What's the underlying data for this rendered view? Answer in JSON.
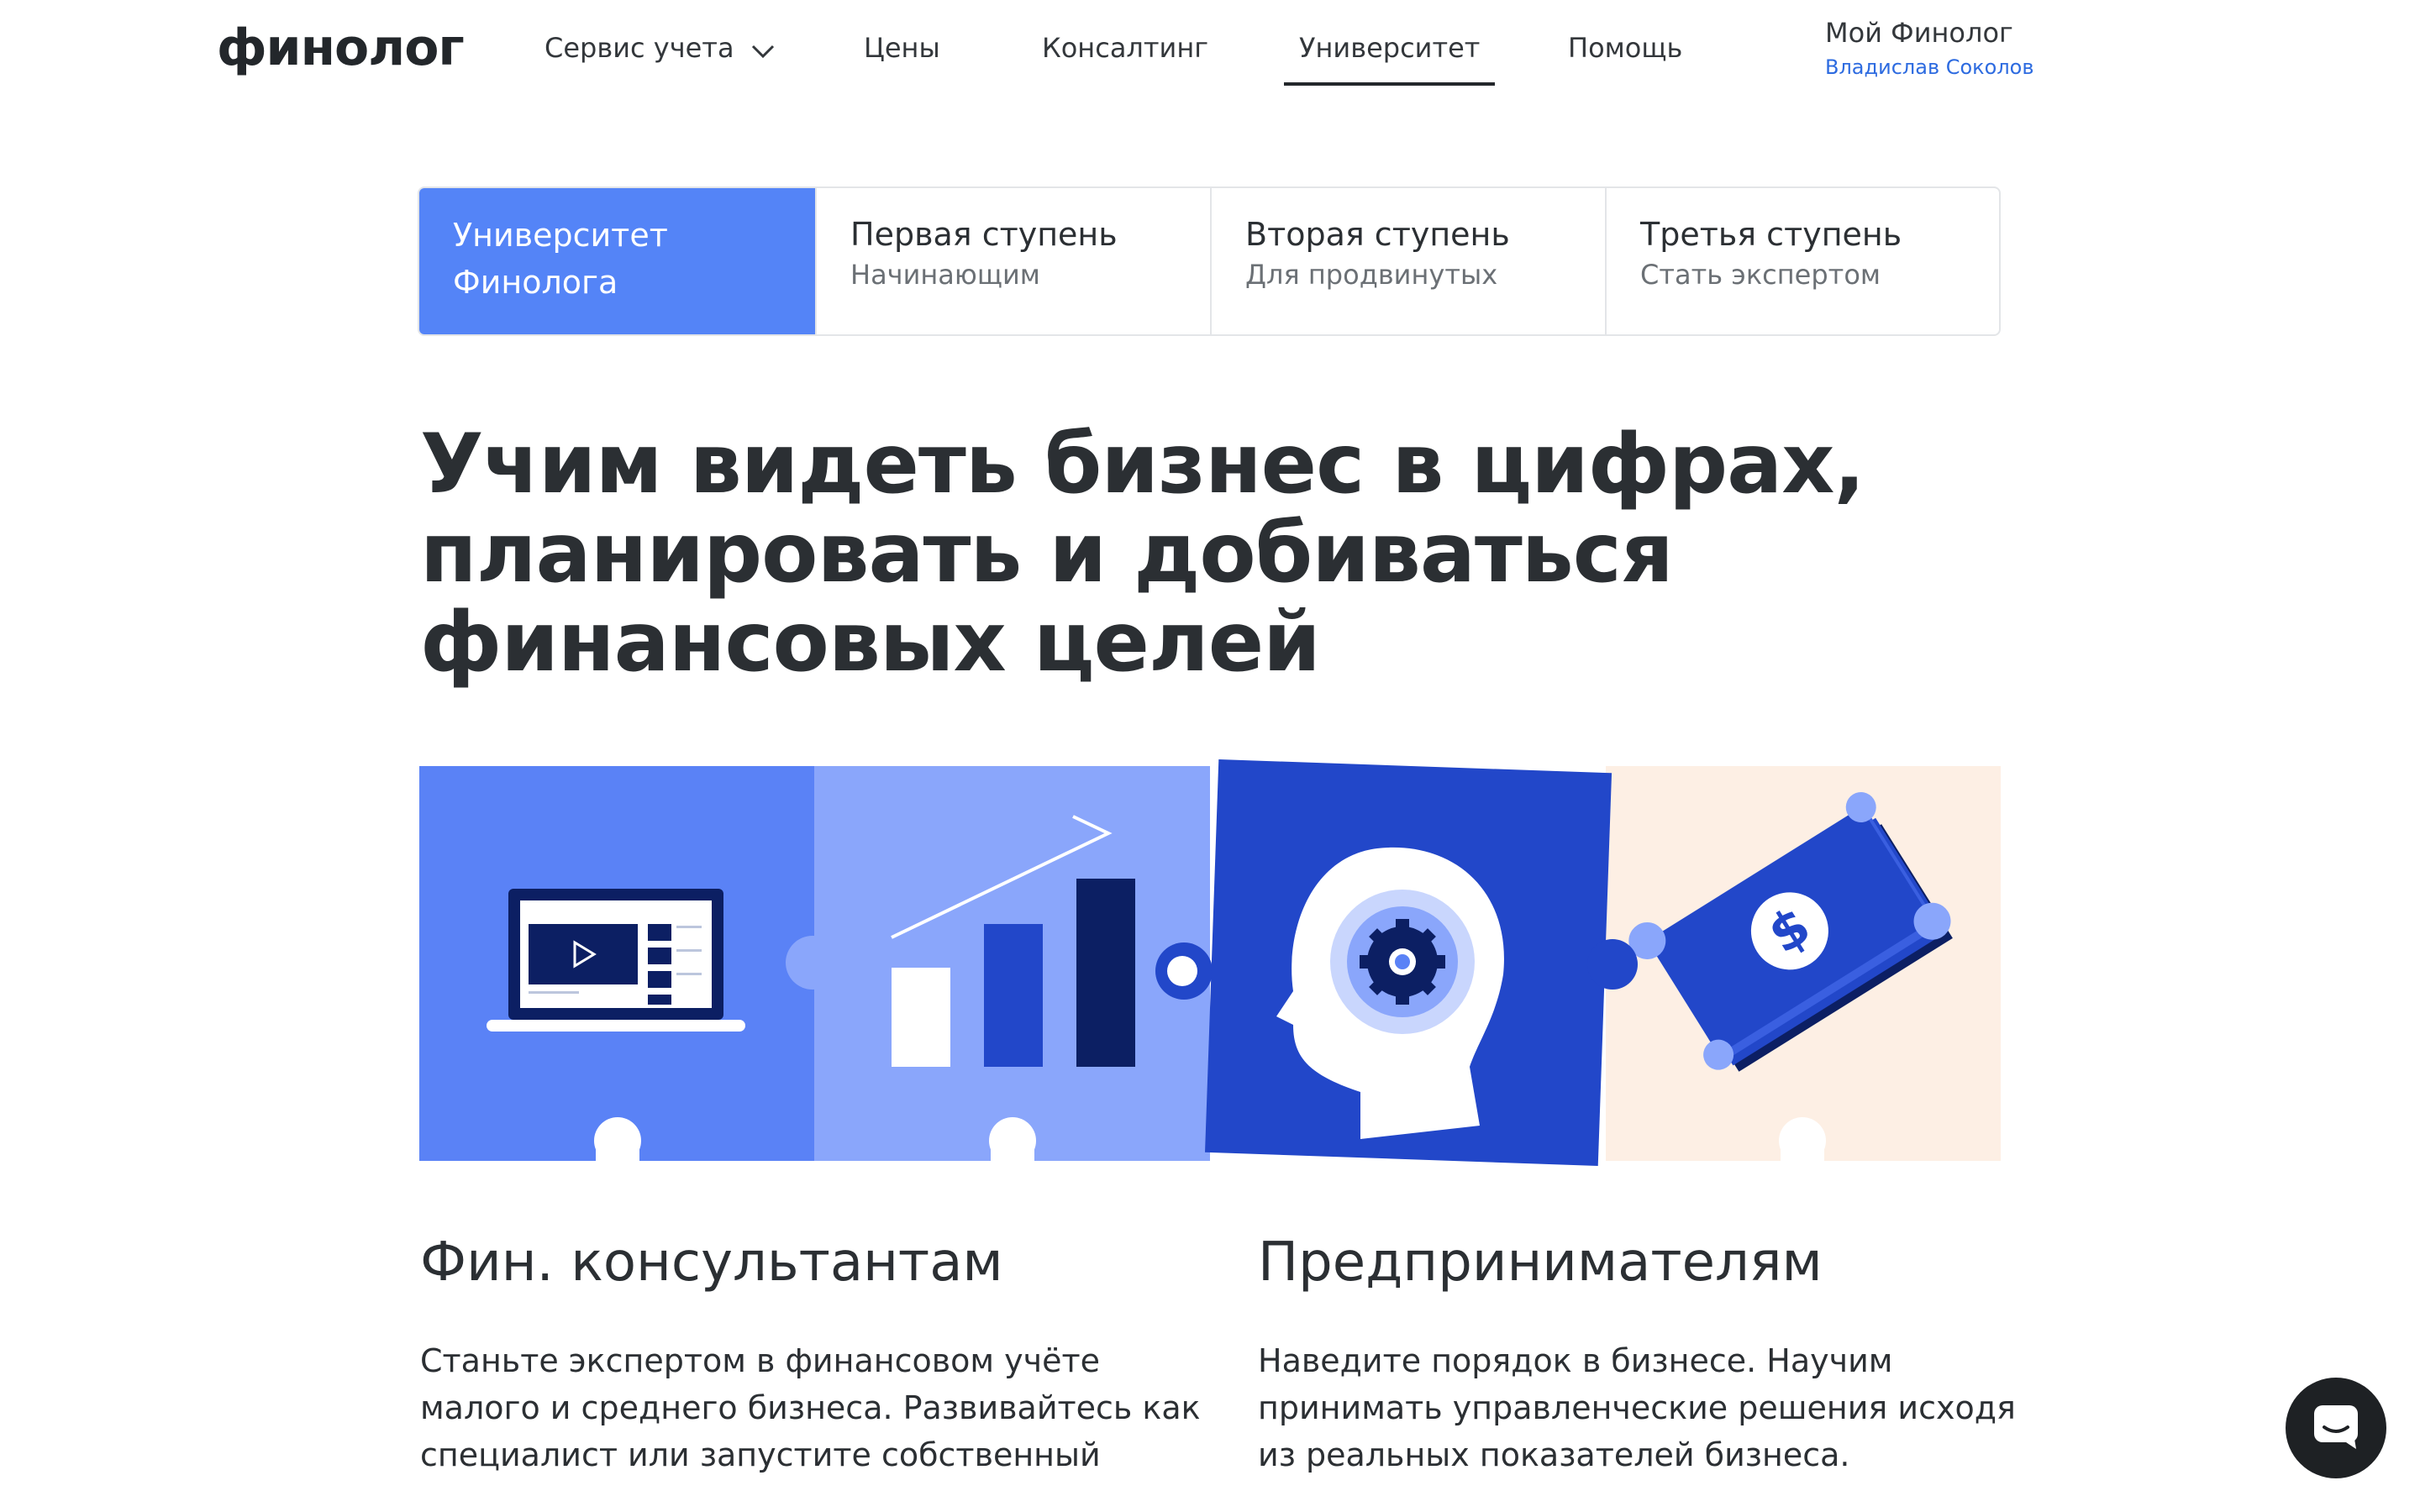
{
  "header": {
    "logo": "финолог",
    "nav": [
      {
        "label": "Сервис учета",
        "has_dropdown": true
      },
      {
        "label": "Цены"
      },
      {
        "label": "Консалтинг"
      },
      {
        "label": "Университет",
        "active": true
      },
      {
        "label": "Помощь"
      }
    ],
    "account": {
      "title": "Мой Финолог",
      "user": "Владислав Соколов"
    }
  },
  "tabs": [
    {
      "title_line1": "Университет",
      "title_line2": "Финолога",
      "active": true
    },
    {
      "title": "Первая ступень",
      "subtitle": "Начинающим"
    },
    {
      "title": "Вторая ступень",
      "subtitle": "Для продвинутых"
    },
    {
      "title": "Третья ступень",
      "subtitle": "Стать экспертом"
    }
  ],
  "headline": {
    "line1": "Учим видеть бизнес в цифрах,",
    "line2": "планировать и добиваться",
    "line3": "финансовых целей"
  },
  "illustration": {
    "icons": [
      "laptop-video-icon",
      "growth-chart-icon",
      "head-gear-icon",
      "money-bills-icon"
    ],
    "colors": {
      "tile1": "#5a82f6",
      "tile2": "#8aa6fb",
      "tile3": "#2247c9",
      "tile4": "#fdefe4",
      "navy": "#0c1f63",
      "accent_blue": "#2247c9"
    }
  },
  "audiences": [
    {
      "title": "Фин. консультантам",
      "lines": [
        "Станьте экспертом в финансовом учёте",
        "малого и среднего бизнеса. Развивайтесь как",
        "специалист или запустите собственный"
      ]
    },
    {
      "title": "Предпринимателям",
      "lines": [
        "Наведите порядок в бизнесе. Научим",
        "принимать управленческие решения исходя",
        "из реальных показателей бизнеса."
      ]
    }
  ],
  "chat": {
    "icon": "chat-icon"
  },
  "colors": {
    "brand_blue": "#5484f7",
    "link_blue": "#2d6be0",
    "text": "#2b2f33"
  }
}
